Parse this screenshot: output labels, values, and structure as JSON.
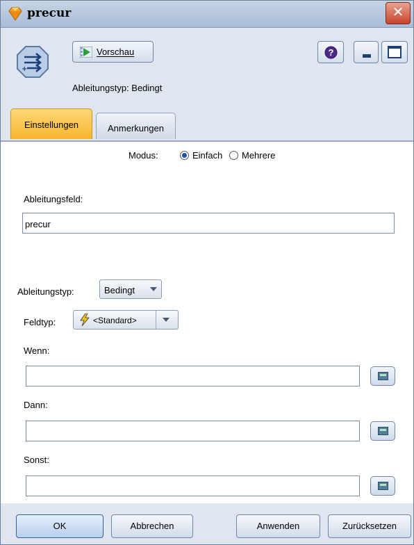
{
  "window": {
    "title": "precur",
    "close_glyph": "✕"
  },
  "toolbar": {
    "preview_label": "Vorschau",
    "preview_underline": "V",
    "help_glyph": "?",
    "derive_type_caption": "Ableitungstyp: Bedingt"
  },
  "tabs": [
    {
      "label": "Einstellungen",
      "active": true
    },
    {
      "label": "Anmerkungen",
      "active": false
    }
  ],
  "settings": {
    "mode_label": "Modus:",
    "mode_options": [
      {
        "label": "Einfach",
        "selected": true
      },
      {
        "label": "Mehrere",
        "selected": false
      }
    ],
    "derive_field_label": "Ableitungsfeld:",
    "derive_field_value": "precur",
    "derive_type_label": "Ableitungstyp:",
    "derive_type_value": "Bedingt",
    "field_type_label": "Feldtyp:",
    "field_type_value": "<Standard>",
    "if_label": "Wenn:",
    "if_value": "",
    "then_label": "Dann:",
    "then_value": "",
    "else_label": "Sonst:",
    "else_value": ""
  },
  "footer": {
    "ok_label": "OK",
    "cancel_label": "Abbrechen",
    "apply_label": "Anwenden",
    "reset_label": "Zurücksetzen"
  },
  "icons": {
    "title": "gem-icon",
    "node": "derive-node-icon",
    "preview": "preview-icon",
    "help": "help-icon",
    "minimize": "minimize-icon",
    "maximize": "maximize-icon",
    "field_type": "lightning-icon",
    "calculator": "expression-builder-icon"
  },
  "colors": {
    "active_tab": "#f6b62d",
    "chrome": "#dfe6ef",
    "close": "#c7432a"
  }
}
